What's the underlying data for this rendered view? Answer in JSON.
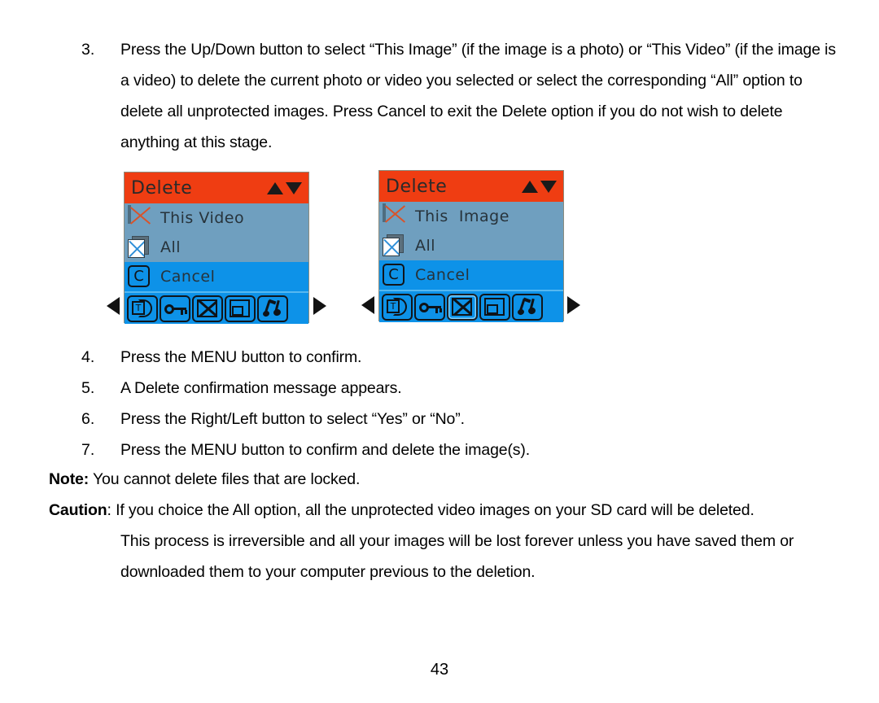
{
  "document": {
    "page_number": "43"
  },
  "steps": [
    {
      "number": "3.",
      "text": "Press the Up/Down button to select “This Image” (if the image is a photo) or “This Video” (if the image is a video) to delete the current photo or video you selected or select the corresponding “All” option to delete all unprotected images. Press Cancel to exit the Delete option if you do not wish to delete anything at this stage."
    },
    {
      "number": "4.",
      "text": "Press the MENU button to confirm."
    },
    {
      "number": "5.",
      "text": "A Delete confirmation message appears."
    },
    {
      "number": "6.",
      "text": "Press the Right/Left button to select “Yes” or “No”."
    },
    {
      "number": "7.",
      "text": "Press the MENU button to confirm and delete the image(s)."
    }
  ],
  "note": {
    "lead": "Note:",
    "text": " You cannot delete files that are locked."
  },
  "caution": {
    "lead": "Caution",
    "text": ": If you choice the All option, all the unprotected video images on your SD card will be deleted.",
    "continuation_1": "This process is irreversible and all your images will be lost forever unless you have saved them or",
    "continuation_2": "downloaded them to your computer previous to the deletion."
  },
  "colors": {
    "header_orange": "#ef3d12",
    "body_blue": "#6f9fbf",
    "highlight_blue": "#0d92e8",
    "toolbar_blue": "#0d92e8",
    "icon_black": "#0e1318",
    "x_red": "#d9532a",
    "x_blue": "#2f8fd8"
  },
  "screens": [
    {
      "id": "screen-video",
      "title": "Delete",
      "updown_icon": "up-down-arrows-icon",
      "rows": [
        {
          "icon": "delete-single-x-icon",
          "label": "This Video",
          "selected": false
        },
        {
          "icon": "delete-all-stack-icon",
          "label": "All",
          "selected": false
        },
        {
          "icon": "cancel-c-icon",
          "label": "Cancel",
          "selected": true
        }
      ],
      "toolbar": [
        {
          "icon": "thumbnail-t-icon",
          "active": false
        },
        {
          "icon": "key-protect-icon",
          "active": false
        },
        {
          "icon": "delete-x-icon",
          "active": false
        },
        {
          "icon": "resize-square-icon",
          "active": false
        },
        {
          "icon": "effect-note-icon",
          "active": false
        }
      ],
      "nav": {
        "left": "prev-arrow-icon",
        "right": "next-arrow-icon"
      }
    },
    {
      "id": "screen-image",
      "title": "Delete",
      "updown_icon": "up-down-arrows-icon",
      "rows": [
        {
          "icon": "delete-single-x-icon",
          "label": "This  Image",
          "selected": false
        },
        {
          "icon": "delete-all-stack-icon",
          "label": "All",
          "selected": false
        },
        {
          "icon": "cancel-c-icon",
          "label": "Cancel",
          "selected": true
        }
      ],
      "toolbar": [
        {
          "icon": "thumbnail-t-icon",
          "active": false
        },
        {
          "icon": "key-protect-icon",
          "active": false
        },
        {
          "icon": "delete-x-icon",
          "active": true
        },
        {
          "icon": "resize-square-icon",
          "active": false
        },
        {
          "icon": "effect-note-icon",
          "active": false
        }
      ],
      "nav": {
        "left": "prev-arrow-icon",
        "right": "next-arrow-icon"
      }
    }
  ]
}
